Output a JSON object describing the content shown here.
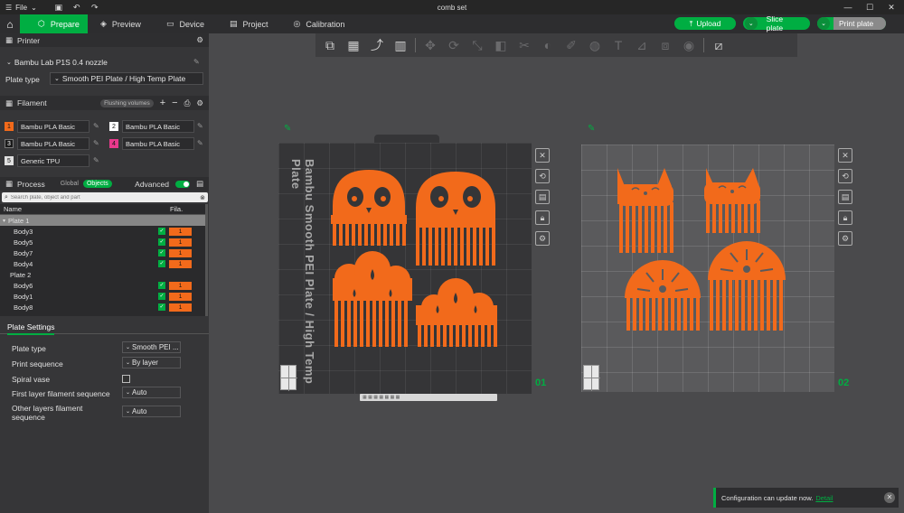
{
  "titlebar": {
    "file_menu": "File",
    "title": "comb set"
  },
  "nav": {
    "tabs": [
      {
        "label": "Prepare",
        "icon": "cube-icon"
      },
      {
        "label": "Preview",
        "icon": "layers-icon"
      },
      {
        "label": "Device",
        "icon": "monitor-icon"
      },
      {
        "label": "Project",
        "icon": "project-icon"
      },
      {
        "label": "Calibration",
        "icon": "calibration-icon"
      }
    ],
    "upload": "Upload",
    "slice": "Slice plate",
    "print": "Print plate"
  },
  "printer": {
    "header": "Printer",
    "model": "Bambu Lab P1S 0.4 nozzle",
    "plate_type_label": "Plate type",
    "plate_type_value": "Smooth PEI Plate / High Temp Plate"
  },
  "filament": {
    "header": "Filament",
    "flushing": "Flushing volumes",
    "items": [
      {
        "num": "1",
        "name": "Bambu PLA Basic",
        "color": "#f26a1b"
      },
      {
        "num": "2",
        "name": "Bambu PLA Basic",
        "color": "#ffffff"
      },
      {
        "num": "3",
        "name": "Bambu PLA Basic",
        "color": "#1a1a1a"
      },
      {
        "num": "4",
        "name": "Bambu PLA Basic",
        "color": "#e8398c"
      },
      {
        "num": "5",
        "name": "Generic TPU",
        "color": "#e0e0e0"
      }
    ]
  },
  "process": {
    "header": "Process",
    "global": "Global",
    "objects": "Objects",
    "advanced": "Advanced",
    "search_placeholder": "Search plate, object and part",
    "col_name": "Name",
    "col_fila": "Fila.",
    "rows": [
      {
        "name": "Plate 1",
        "type": "plate",
        "selected": true
      },
      {
        "name": "Body3",
        "type": "body",
        "fila": "1"
      },
      {
        "name": "Body5",
        "type": "body",
        "fila": "1"
      },
      {
        "name": "Body7",
        "type": "body",
        "fila": "1"
      },
      {
        "name": "Body4",
        "type": "body",
        "fila": "1"
      },
      {
        "name": "Plate 2",
        "type": "plate"
      },
      {
        "name": "Body6",
        "type": "body",
        "fila": "1"
      },
      {
        "name": "Body1",
        "type": "body",
        "fila": "1"
      },
      {
        "name": "Body8",
        "type": "body",
        "fila": "1"
      }
    ]
  },
  "plate_settings": {
    "tab": "Plate Settings",
    "rows": [
      {
        "label": "Plate type",
        "value": "Smooth PEI ..."
      },
      {
        "label": "Print sequence",
        "value": "By layer"
      },
      {
        "label": "Spiral vase",
        "value": ""
      },
      {
        "label": "First layer filament sequence",
        "value": "Auto"
      },
      {
        "label": "Other layers filament sequence",
        "value": "Auto"
      }
    ]
  },
  "viewport": {
    "plate1_label": "Bambu Smooth PEI Plate / High Temp Plate",
    "plate1_num": "01",
    "plate2_num": "02",
    "model_color": "#f26a1b"
  },
  "notice": {
    "text": "Configuration can update now.",
    "link": "Detail"
  }
}
